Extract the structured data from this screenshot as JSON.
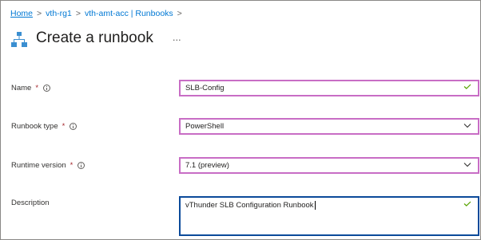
{
  "breadcrumb": {
    "items": [
      {
        "label": "Home"
      },
      {
        "label": "vth-rg1"
      },
      {
        "label": "vth-amt-acc | Runbooks"
      }
    ],
    "separator": ">"
  },
  "page": {
    "title": "Create a runbook",
    "more_label": "...",
    "icon": "runbook-hierarchy-icon"
  },
  "form": {
    "name": {
      "label": "Name",
      "required_marker": "*",
      "value": "SLB-Config",
      "valid": true
    },
    "runbook_type": {
      "label": "Runbook type",
      "required_marker": "*",
      "value": "PowerShell"
    },
    "runtime_version": {
      "label": "Runtime version",
      "required_marker": "*",
      "value": "7.1 (preview)"
    },
    "description": {
      "label": "Description",
      "value": "vThunder SLB Configuration Runbook",
      "valid": true
    }
  },
  "colors": {
    "link": "#0078d4",
    "field_border_highlight": "#c86dc5",
    "description_border": "#0b4a9a",
    "required": "#a4262c",
    "valid_check": "#57a300",
    "icon_blue": "#3b8fd1"
  }
}
